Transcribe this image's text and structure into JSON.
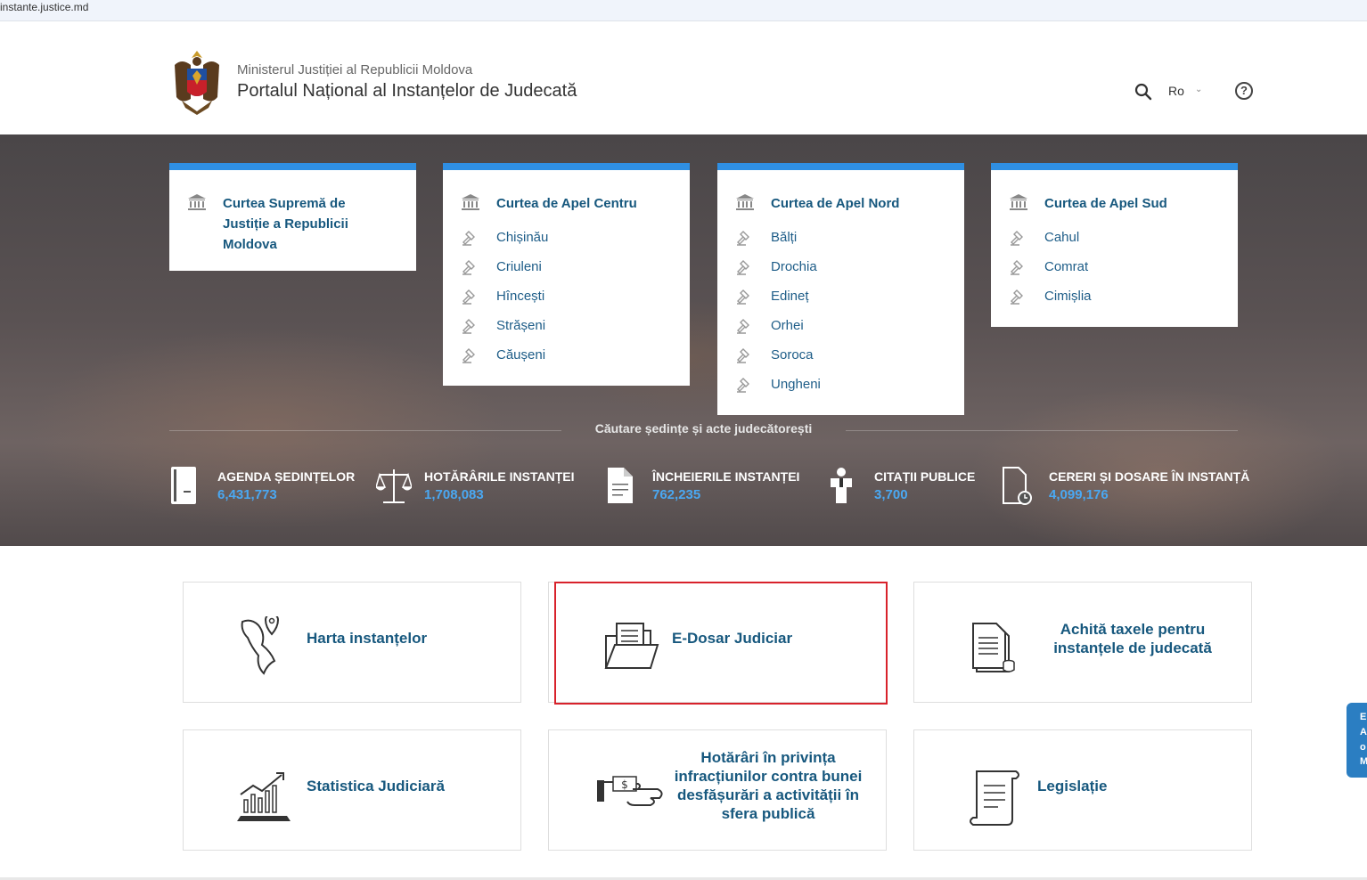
{
  "browser": {
    "url": "instante.justice.md"
  },
  "header": {
    "ministry": "Ministerul Justiției al Republicii Moldova",
    "portal": "Portalul Național al Instanțelor de Judecată",
    "language": "Ro"
  },
  "courts": [
    {
      "title": "Curtea Supremă de Justiție a Republicii Moldova",
      "items": []
    },
    {
      "title": "Curtea de Apel Centru",
      "items": [
        "Chișinău",
        "Criuleni",
        "Hîncești",
        "Strășeni",
        "Căușeni"
      ]
    },
    {
      "title": "Curtea de Apel Nord",
      "items": [
        "Bălți",
        "Drochia",
        "Edineț",
        "Orhei",
        "Soroca",
        "Ungheni"
      ]
    },
    {
      "title": "Curtea de Apel Sud",
      "items": [
        "Cahul",
        "Comrat",
        "Cimișlia"
      ]
    }
  ],
  "search_caption": "Căutare ședințe și acte judecătorești",
  "stats": [
    {
      "label": "AGENDA ȘEDINȚELOR",
      "value": "6,431,773",
      "icon": "agenda-icon"
    },
    {
      "label": "HOTĂRÂRILE INSTANȚEI",
      "value": "1,708,083",
      "icon": "scales-icon"
    },
    {
      "label": "ÎNCHEIERILE INSTANȚEI",
      "value": "762,235",
      "icon": "document-icon"
    },
    {
      "label": "CITAȚII PUBLICE",
      "value": "3,700",
      "icon": "person-icon"
    },
    {
      "label": "CERERI ȘI DOSARE ÎN INSTANȚĂ",
      "value": "4,099,176",
      "icon": "file-clock-icon"
    }
  ],
  "tiles": {
    "map": "Harta instanțelor",
    "edosar": "E-Dosar Judiciar",
    "taxes_line1": "Achită taxele pentru",
    "taxes_line2": "instanțele de judecată",
    "stats": "Statistica Judiciară",
    "decisions_line1": "Hotărâri în privința",
    "decisions_line2": "infracțiunilor contra bunei",
    "decisions_line3": "desfășurări a activității în",
    "decisions_line4": "sfera publică",
    "legislation": "Legislație"
  },
  "side_tab": [
    "E",
    "A",
    "o",
    "M"
  ],
  "colors": {
    "accent": "#2f8fe3",
    "link": "#17587e",
    "stat_value": "#4aa8f2",
    "highlight": "#d8222b"
  }
}
